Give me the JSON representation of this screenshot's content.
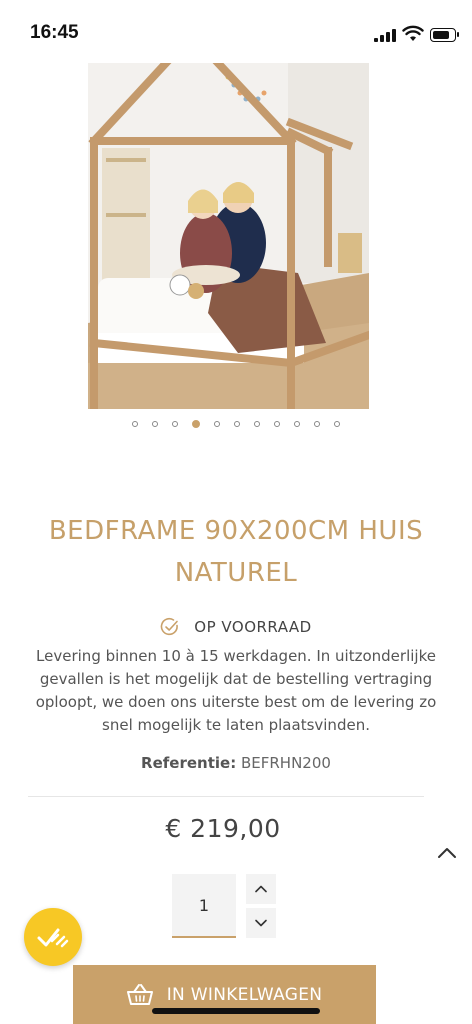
{
  "status_bar": {
    "time": "16:45"
  },
  "gallery": {
    "image_alt": "Bedframe huis naturel",
    "slide_count": 11,
    "active_index": 3
  },
  "product": {
    "title": "BEDFRAME 90X200CM HUIS NATUREL",
    "stock_label": "OP VOORRAAD",
    "delivery_text": "Levering binnen 10 à 15 werkdagen. In uitzonderlijke gevallen is het mogelijk dat de bestelling vertraging oploopt, we doen ons uiterste best om de levering zo snel mogelijk te laten plaatsvinden.",
    "reference_label": "Referentie:",
    "reference_value": "BEFRHN200",
    "price": "€ 219,00"
  },
  "quantity": {
    "value": "1"
  },
  "cart_button": {
    "label": "IN WINKELWAGEN"
  },
  "colors": {
    "accent": "#c9a16a",
    "title": "#c6a06a",
    "badge": "#f7c825"
  },
  "icons": {
    "stock": "check-circle-icon",
    "qty_up": "chevron-up-icon",
    "qty_down": "chevron-down-icon",
    "scroll": "chevron-up-icon",
    "badge": "checkmark-badge-icon",
    "cart": "basket-icon"
  }
}
